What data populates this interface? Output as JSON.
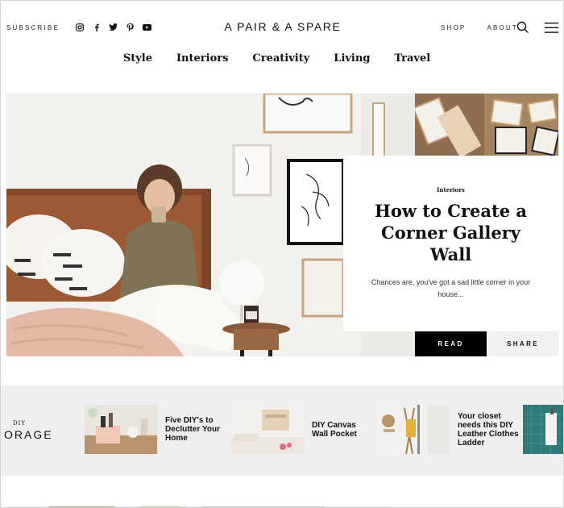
{
  "header": {
    "subscribe": "SUBSCRIBE",
    "brand": "A PAIR & A SPARE",
    "nav": [
      "SHOP",
      "ABOUT"
    ],
    "social_icons": [
      "instagram-icon",
      "facebook-icon",
      "twitter-icon",
      "pinterest-icon",
      "youtube-icon"
    ]
  },
  "categories": [
    "Style",
    "Interiors",
    "Creativity",
    "Living",
    "Travel"
  ],
  "hero": {
    "category": "Interiors",
    "title": "How to Create a Corner Gallery Wall",
    "excerpt": "Chances are, you've got a sad little corner in your house...",
    "read": "READ",
    "share": "SHARE"
  },
  "strip": {
    "small_label": "DIY",
    "big_label": "ORAGE",
    "items": [
      {
        "label": "Five DIY's to Declutter Your Home"
      },
      {
        "label": "DIY Canvas Wall Pocket"
      },
      {
        "label": "Your closet needs this DIY Leather Clothes Ladder"
      }
    ]
  }
}
